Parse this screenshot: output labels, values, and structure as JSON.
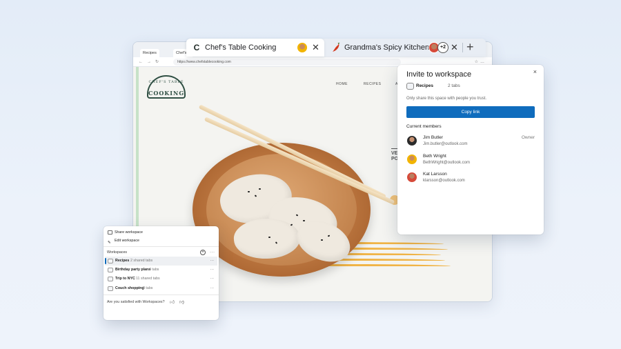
{
  "browser": {
    "mini_tabs": [
      "Recipes",
      "Chef's Tabl"
    ],
    "url": "https://www.chefstablecooking.com",
    "site": {
      "logo_top": "CHEF'S TABLE",
      "logo_bottom": "COOKING",
      "nav": [
        "HOME",
        "RECIPES",
        "A"
      ],
      "ve_text_1": "VE",
      "ve_text_2": "PO"
    }
  },
  "tabs": {
    "active": {
      "favicon": "C",
      "title": "Chef's Table Cooking"
    },
    "inactive": {
      "favicon": "chili-icon",
      "title": "Grandma's Spicy Kitchen"
    },
    "extra_count": "+2",
    "new_tab": "+"
  },
  "invite": {
    "title": "Invite to workspace",
    "close": "×",
    "workspace_name": "Recipes",
    "workspace_tabs": "2 tabs",
    "note": "Only share this space with people you trust.",
    "copy_link": "Copy link",
    "members_label": "Current members",
    "members": [
      {
        "name": "Jim Butler",
        "email": "Jim.butler@outlook.com",
        "role": "Owner"
      },
      {
        "name": "Beth Wright",
        "email": "BethWright@outlook.com",
        "role": ""
      },
      {
        "name": "Kat Larsson",
        "email": "klarsson@outlook.com",
        "role": ""
      }
    ]
  },
  "menu": {
    "share": "Share workspace",
    "edit": "Edit workspace",
    "header": "Workspaces",
    "workspaces": [
      {
        "name": "Recipes",
        "count": "2 shared tabs",
        "selected": true
      },
      {
        "name": "Birthday party plans",
        "count": "4 tabs",
        "selected": false
      },
      {
        "name": "Trip to NYC",
        "count": "11 shared tabs",
        "selected": false
      },
      {
        "name": "Couch shopping",
        "count": "8 tabs",
        "selected": false
      }
    ],
    "feedback": "Are you satisfied with Workspaces?"
  },
  "colors": {
    "accent": "#0f6cbd",
    "wave": "#f0b447",
    "site_bg": "#f4f4f1"
  }
}
